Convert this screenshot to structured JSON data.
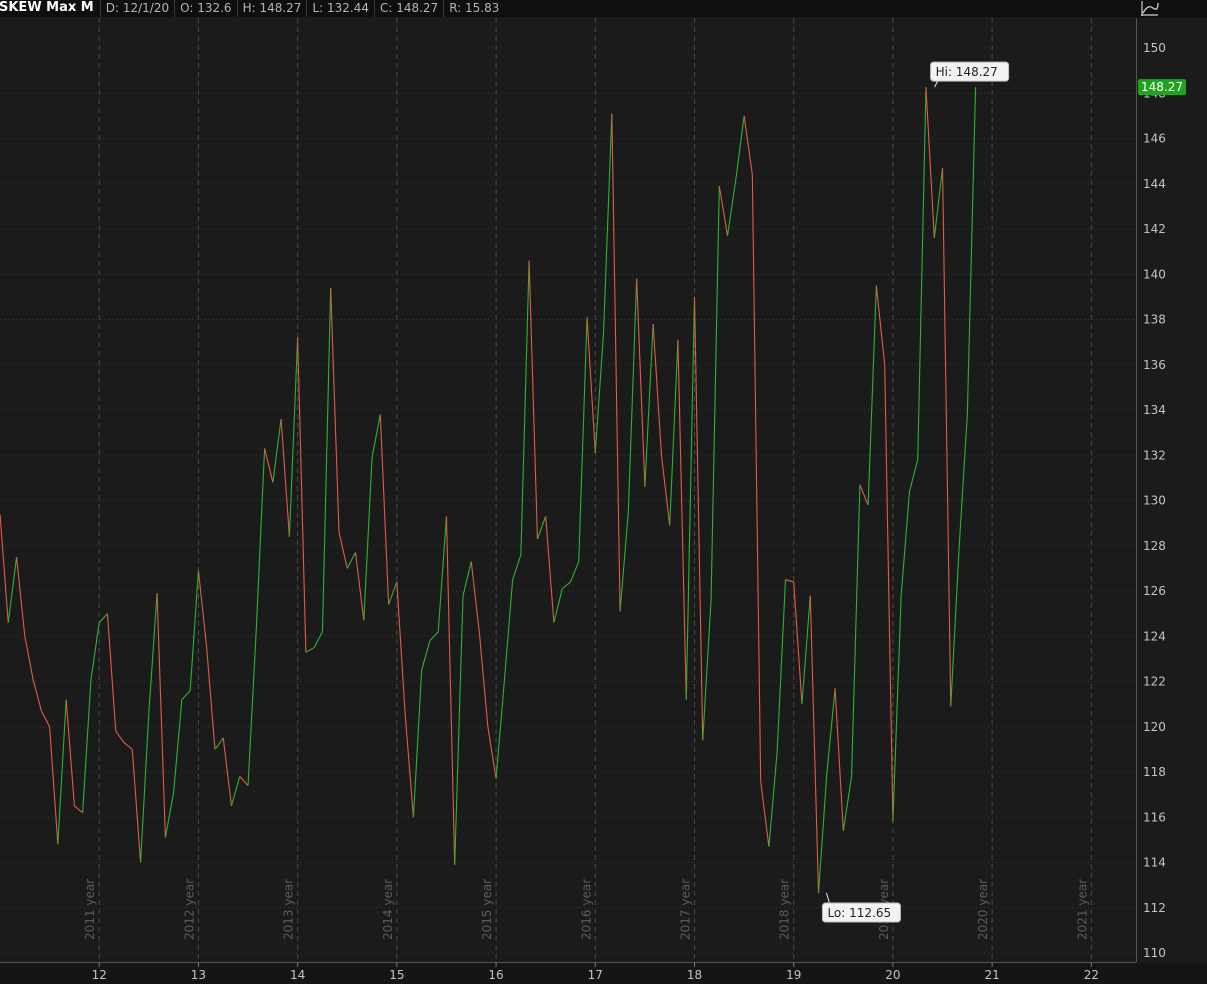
{
  "header": {
    "symbol": "SKEW Max M",
    "date": "D: 12/1/20",
    "open": "O: 132.6",
    "high": "H: 148.27",
    "low": "L: 132.44",
    "close": "C: 148.27",
    "range": "R: 15.83"
  },
  "colors": {
    "background": "#1b1b1b",
    "up": "#2fb32f",
    "down": "#e35d45",
    "grid": "#3a3a3a",
    "last_price_badge": "#1fa31f"
  },
  "chart_data": {
    "type": "line",
    "y_ticks": [
      "110",
      "112",
      "114",
      "116",
      "118",
      "120",
      "122",
      "124",
      "126",
      "128",
      "130",
      "132",
      "134",
      "136",
      "138",
      "140",
      "142",
      "144",
      "146",
      "148",
      "150"
    ],
    "x_ticks": [
      "12",
      "13",
      "14",
      "15",
      "16",
      "17",
      "18",
      "19",
      "20",
      "21",
      "22"
    ],
    "year_labels": [
      "2011 year",
      "2012 year",
      "2013 year",
      "2014 year",
      "2015 year",
      "2016 year",
      "2017 year",
      "2018 year",
      "2019 year",
      "2020 year",
      "2021 year"
    ],
    "ylim": [
      110,
      150.5
    ],
    "xlim": [
      2011.0,
      2022.45
    ],
    "grid": true,
    "hi_label": "Hi: 148.27",
    "lo_label": "Lo: 112.65",
    "last_price": "148.27",
    "hi": {
      "x": 2020.42,
      "y": 148.27
    },
    "lo": {
      "x": 2019.33,
      "y": 112.65
    },
    "x": [
      2011.0,
      2011.083,
      2011.167,
      2011.25,
      2011.333,
      2011.417,
      2011.5,
      2011.583,
      2011.667,
      2011.75,
      2011.833,
      2011.917,
      2012.0,
      2012.083,
      2012.167,
      2012.25,
      2012.333,
      2012.417,
      2012.5,
      2012.583,
      2012.667,
      2012.75,
      2012.833,
      2012.917,
      2013.0,
      2013.083,
      2013.167,
      2013.25,
      2013.333,
      2013.417,
      2013.5,
      2013.583,
      2013.667,
      2013.75,
      2013.833,
      2013.917,
      2014.0,
      2014.083,
      2014.167,
      2014.25,
      2014.333,
      2014.417,
      2014.5,
      2014.583,
      2014.667,
      2014.75,
      2014.833,
      2014.917,
      2015.0,
      2015.083,
      2015.167,
      2015.25,
      2015.333,
      2015.417,
      2015.5,
      2015.583,
      2015.667,
      2015.75,
      2015.833,
      2015.917,
      2016.0,
      2016.083,
      2016.167,
      2016.25,
      2016.333,
      2016.417,
      2016.5,
      2016.583,
      2016.667,
      2016.75,
      2016.833,
      2016.917,
      2017.0,
      2017.083,
      2017.167,
      2017.25,
      2017.333,
      2017.417,
      2017.5,
      2017.583,
      2017.667,
      2017.75,
      2017.833,
      2017.917,
      2018.0,
      2018.083,
      2018.167,
      2018.25,
      2018.333,
      2018.417,
      2018.5,
      2018.583,
      2018.667,
      2018.75,
      2018.833,
      2018.917,
      2019.0,
      2019.083,
      2019.167,
      2019.25,
      2019.333,
      2019.417,
      2019.5,
      2019.583,
      2019.667,
      2019.75,
      2019.833,
      2019.917,
      2020.0,
      2020.083,
      2020.167,
      2020.25,
      2020.333,
      2020.417,
      2020.5,
      2020.583,
      2020.667,
      2020.75,
      2020.833,
      2020.917
    ],
    "series": [
      {
        "values": [
          129.4,
          124.6,
          127.5,
          124.0,
          122.1,
          120.7,
          120.0,
          114.8,
          121.2,
          116.5,
          116.2,
          122.1,
          124.6,
          125.0,
          119.8,
          119.3,
          119.0,
          114.0,
          120.6,
          125.9,
          115.1,
          117.1,
          121.2,
          121.6,
          126.9,
          123.5,
          119.0,
          119.5,
          116.5,
          117.8,
          117.4,
          124.3,
          132.3,
          130.8,
          133.6,
          128.4,
          137.2,
          123.3,
          123.5,
          124.2,
          139.4,
          128.6,
          127.0,
          127.7,
          124.7,
          131.9,
          133.8,
          125.4,
          126.4,
          120.6,
          116.0,
          122.5,
          123.8,
          124.2,
          129.3,
          113.9,
          125.8,
          127.3,
          124.1,
          120.0,
          117.7,
          122.0,
          126.5,
          127.6,
          140.6,
          128.3,
          129.3,
          124.6,
          126.1,
          126.4,
          127.3,
          138.1,
          132.1,
          137.4,
          147.1,
          125.1,
          129.5,
          139.8,
          130.6,
          137.8,
          132.0,
          128.9,
          137.1,
          121.2,
          139.0,
          119.4,
          125.6,
          143.9,
          141.7,
          144.2,
          147.0,
          144.4,
          117.6,
          114.7,
          118.9,
          126.5,
          126.4,
          121.0,
          125.8,
          112.65,
          117.9,
          121.7,
          115.4,
          117.8,
          130.7,
          129.8,
          139.5,
          136.0,
          115.8,
          125.8,
          130.4,
          131.8,
          148.27,
          141.6,
          144.7,
          120.9,
          127.9,
          133.8,
          148.27
        ]
      }
    ]
  }
}
